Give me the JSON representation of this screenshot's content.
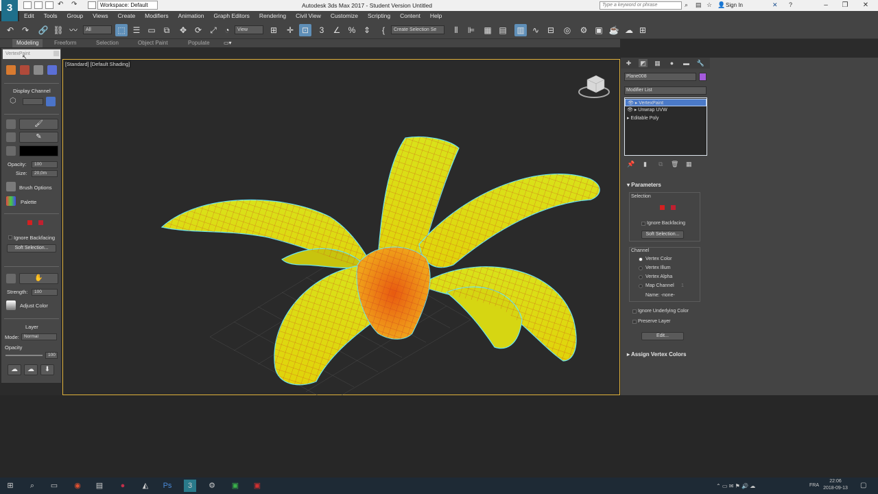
{
  "window": {
    "title": "Autodesk 3ds Max 2017 - Student Version   Untitled",
    "workspace": "Workspace: Default",
    "search_placeholder": "Type a keyword or phrase",
    "sign_in": "Sign In",
    "app_logo": "3"
  },
  "menu": [
    "Edit",
    "Tools",
    "Group",
    "Views",
    "Create",
    "Modifiers",
    "Animation",
    "Graph Editors",
    "Rendering",
    "Civil View",
    "Customize",
    "Scripting",
    "Content",
    "Help"
  ],
  "toolbar": {
    "filter": "All",
    "ref_coord": "View",
    "selection_set": "Create Selection Se"
  },
  "ribbon": {
    "tabs": [
      "Modeling",
      "Freeform",
      "Selection",
      "Object Paint",
      "Populate"
    ]
  },
  "vertex_paint_panel": {
    "title": "VertexPaint",
    "display_channel": "Display Channel",
    "opacity_label": "Opacity:",
    "opacity_value": "100",
    "size_label": "Size:",
    "size_value": "20,0m",
    "brush_options": "Brush Options",
    "palette": "Palette",
    "ignore_backfacing": "Ignore Backfacing",
    "soft_selection": "Soft Selection...",
    "strength_label": "Strength:",
    "strength_value": "100",
    "adjust_color": "Adjust Color",
    "layer": "Layer",
    "mode_label": "Mode:",
    "mode_value": "Normal",
    "layer_opacity_label": "Opacity",
    "layer_opacity_value": "100",
    "paint_color": "#000000"
  },
  "viewport": {
    "label": "[Standard] [Default Shading]"
  },
  "command_panel": {
    "object_name": "Plane008",
    "object_color": "#a55bdc",
    "modifier_list": "Modifier List",
    "stack": [
      "VertexPaint",
      "Unwrap UVW",
      "Editable Poly"
    ],
    "parameters": "Parameters",
    "selection": "Selection",
    "ignore_backfacing": "Ignore Backfacing",
    "soft_selection": "Soft Selection...",
    "channel": "Channel",
    "channels": [
      "Vertex Color",
      "Vertex Illum",
      "Vertex Alpha",
      "Map Channel"
    ],
    "map_channel_value": "1",
    "name_label": "Name: -none-",
    "ignore_underlying": "Ignore Underlying Color",
    "preserve_layer": "Preserve Layer",
    "edit": "Edit...",
    "assign_vertex_colors": "Assign Vertex Colors"
  },
  "taskbar": {
    "lang": "FRA",
    "time": "22:06",
    "date": "2018-09-13"
  },
  "colors": {
    "accent": "#5f8fb8",
    "viewport_border": "#e2b33c",
    "selected": "#4b7ac8"
  }
}
